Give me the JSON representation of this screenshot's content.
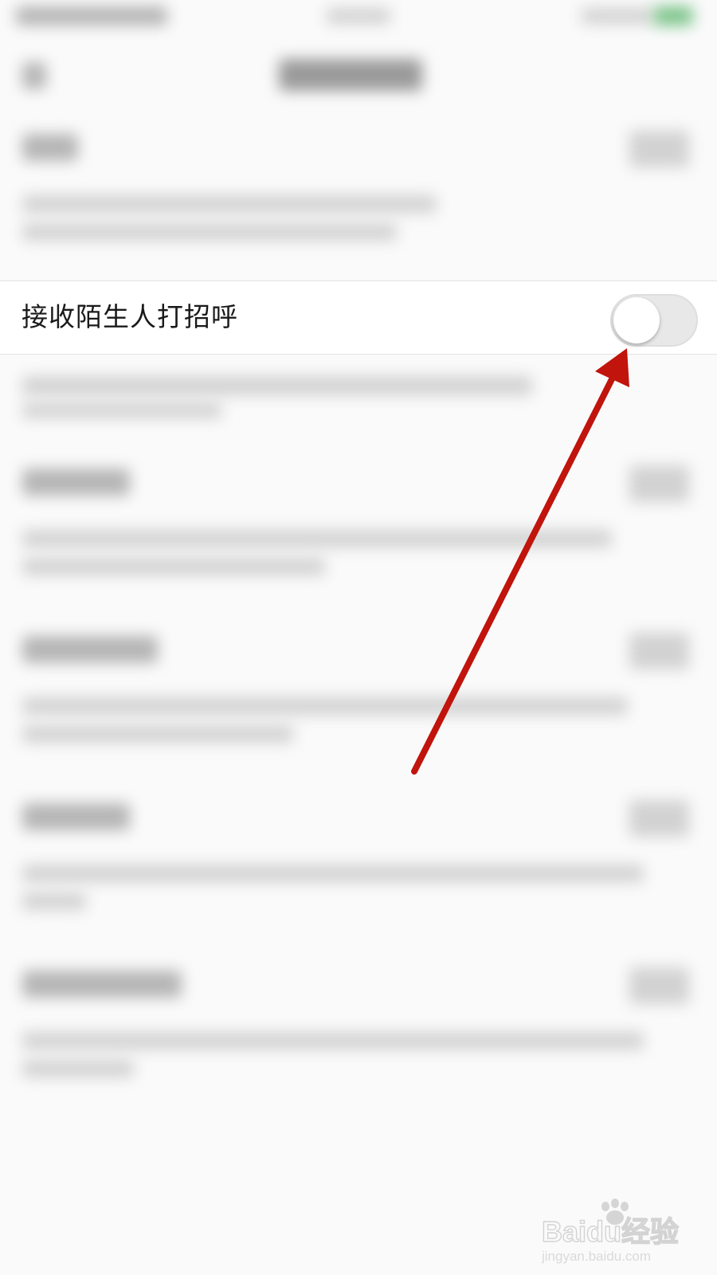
{
  "setting": {
    "label": "接收陌生人打招呼",
    "toggle_state": "off"
  },
  "colors": {
    "arrow": "#c0140c",
    "toggle_track_off": "#e8e8e8",
    "toggle_knob": "#ffffff",
    "row_background": "#ffffff",
    "page_background": "#fafafa"
  },
  "watermark": {
    "brand": "Baidu经验",
    "url": "jingyan.baidu.com"
  }
}
